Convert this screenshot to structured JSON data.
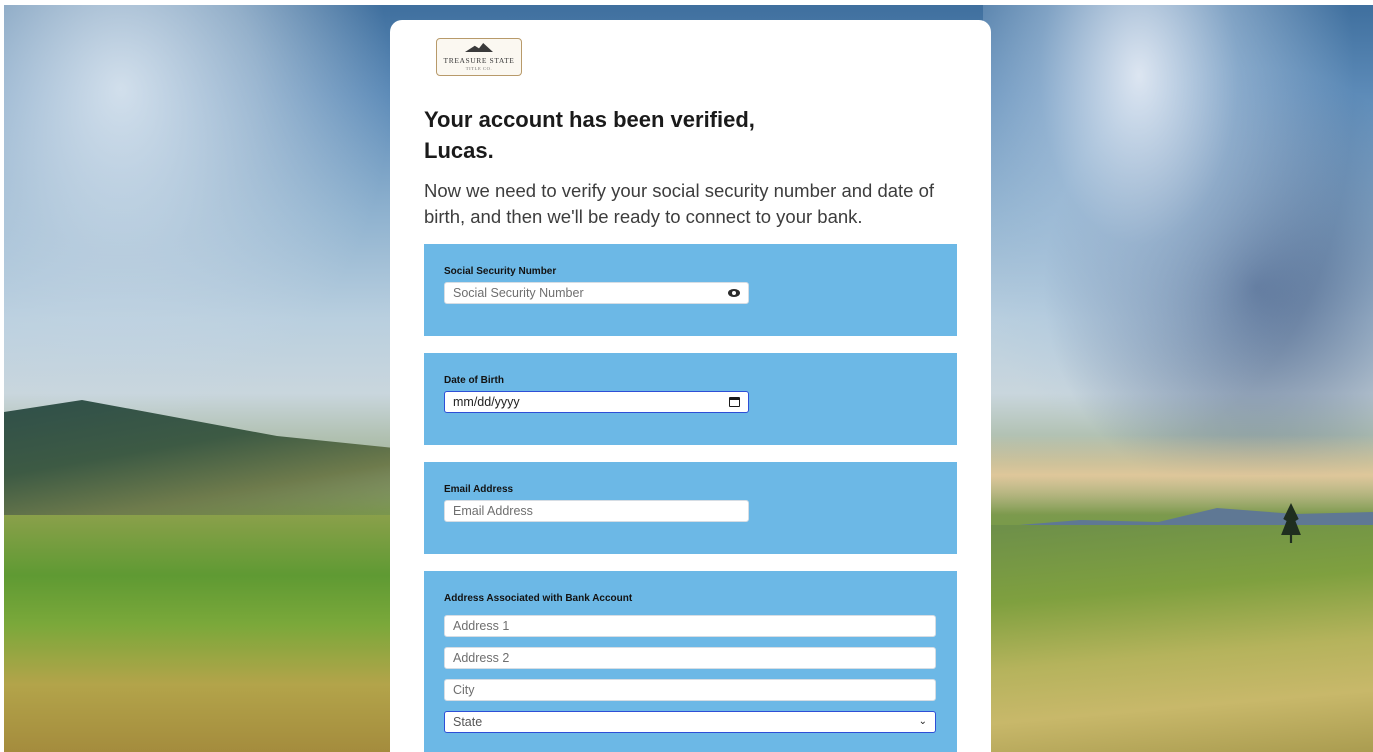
{
  "logo": {
    "name": "TREASURE STATE",
    "sub": "TITLE CO."
  },
  "heading": "Your account has been verified, Lucas.",
  "subtext": "Now we need to verify your social security number and date of birth, and then we'll be ready to connect to your bank.",
  "ssn": {
    "label": "Social Security Number",
    "placeholder": "Social Security Number",
    "icon": "eye-icon"
  },
  "dob": {
    "label": "Date of Birth",
    "placeholder": "mm/dd/yyyy",
    "icon": "calendar-icon"
  },
  "email": {
    "label": "Email Address",
    "placeholder": "Email Address"
  },
  "address": {
    "label": "Address Associated with Bank Account",
    "address1_placeholder": "Address 1",
    "address2_placeholder": "Address 2",
    "city_placeholder": "City",
    "state_selected": "State"
  },
  "colors": {
    "section_bg": "#6cb8e6",
    "focus_border": "#2e4fd6"
  }
}
